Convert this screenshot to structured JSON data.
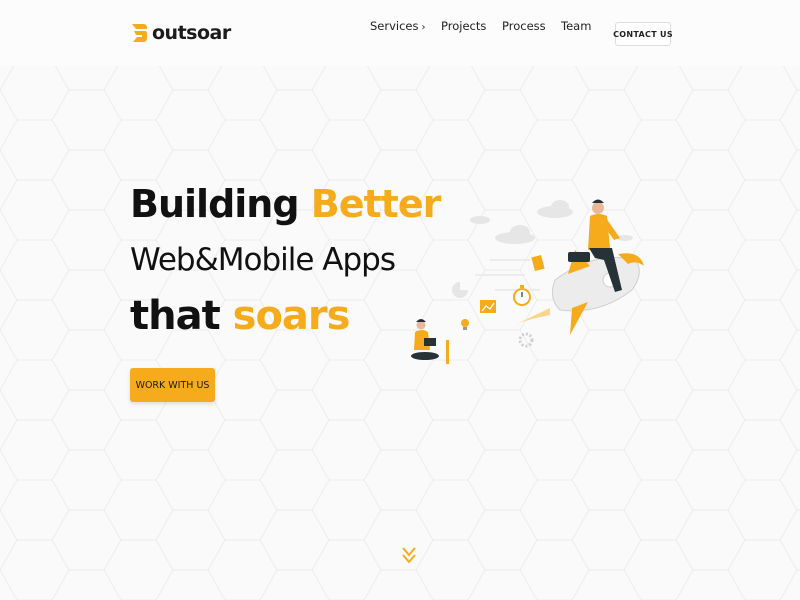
{
  "brand": {
    "name": "outsoar",
    "accent_color": "#f6ab1c",
    "logo_icon": "outsoar-logo-icon"
  },
  "nav": {
    "items": [
      {
        "label": "Services",
        "has_submenu": true,
        "icon": "chevron-right-icon"
      },
      {
        "label": "Projects"
      },
      {
        "label": "Process"
      },
      {
        "label": "Team"
      }
    ],
    "contact_label": "CONTACT US"
  },
  "hero": {
    "line1": {
      "plain": "Building ",
      "accent": "Better"
    },
    "line2": "Web&Mobile Apps",
    "line3": {
      "plain": "that ",
      "accent": "soars"
    },
    "cta_label": "WORK WITH US",
    "illustration": "rocket-launch-illustration"
  },
  "scroll": {
    "icon": "double-chevron-down-icon"
  }
}
